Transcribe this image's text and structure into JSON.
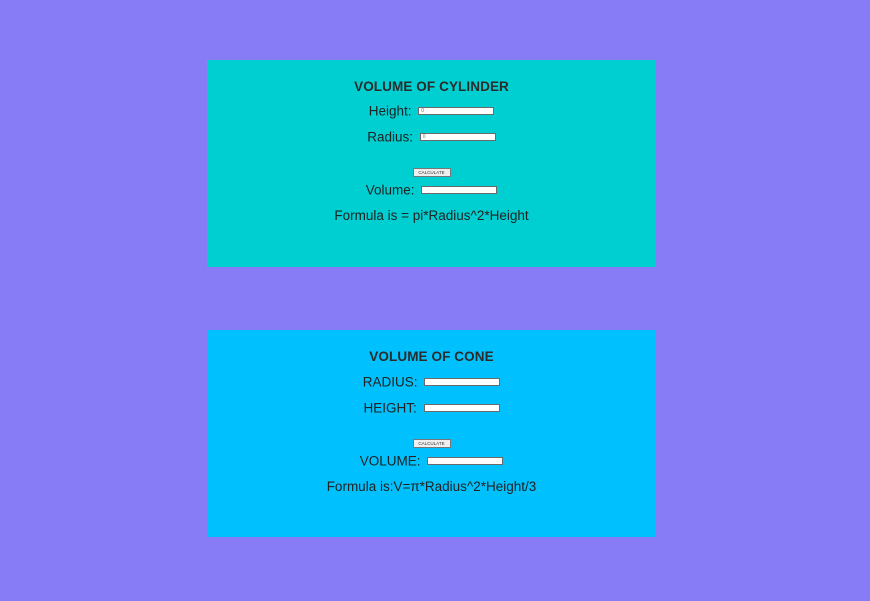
{
  "cylinder": {
    "title": "VOLUME OF CYLINDER",
    "height_label": "Height:",
    "height_value": "0",
    "radius_label": "Radius:",
    "radius_value": "0",
    "calculate_label": "CALCULATE",
    "volume_label": "Volume:",
    "volume_value": "",
    "formula": "Formula is = pi*Radius^2*Height"
  },
  "cone": {
    "title": "VOLUME OF CONE",
    "radius_label": "RADIUS:",
    "radius_value": "",
    "height_label": "HEIGHT:",
    "height_value": "",
    "calculate_label": "CALCULATE",
    "volume_label": "VOLUME:",
    "volume_value": "",
    "formula": "Formula is:V=π*Radius^2*Height/3"
  },
  "colors": {
    "page_background": "#877cf5",
    "cylinder_panel": "#00cfd2",
    "cone_panel": "#00c1fe"
  }
}
